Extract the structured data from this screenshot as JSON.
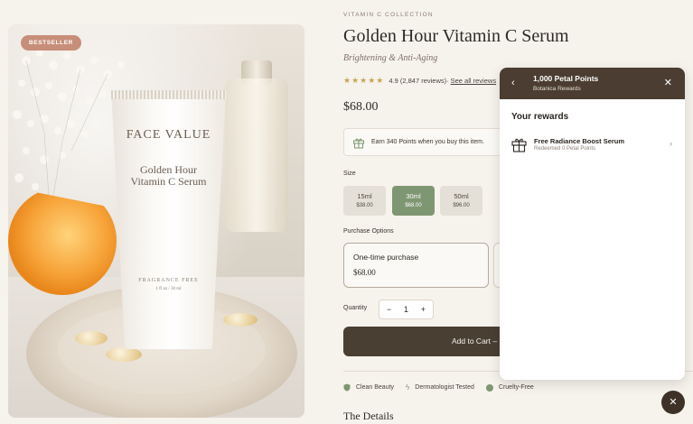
{
  "product_image": {
    "badge": "BESTSELLER",
    "tube_brand": "FACE VALUE",
    "tube_name_line1": "Golden Hour",
    "tube_name_line2": "Vitamin C Serum",
    "tube_fragrance": "FRAGRANCE FREE",
    "tube_volume": "1 fl oz / 30 ml"
  },
  "product": {
    "collection": "VITAMIN C COLLECTION",
    "title": "Golden Hour Vitamin C Serum",
    "subtitle": "Brightening & Anti-Aging",
    "stars": "★★★★★",
    "rating_text": "4.9 (2,847 reviews)·",
    "reviews_link": "See all reviews",
    "price": "$68.00",
    "points_message": "Earn 340 Points when you buy this item."
  },
  "size": {
    "label": "Size",
    "options": [
      {
        "name": "15ml",
        "price": "$38.00"
      },
      {
        "name": "30ml",
        "price": "$68.00"
      },
      {
        "name": "50ml",
        "price": "$96.00"
      }
    ],
    "selected": "30ml"
  },
  "purchase": {
    "label": "Purchase Options",
    "option_title": "One-time purchase",
    "option_price": "$68.00"
  },
  "quantity": {
    "label": "Quantity",
    "minus": "−",
    "value": "1",
    "plus": "+"
  },
  "cart": {
    "button_label": "Add to Cart –"
  },
  "features": [
    {
      "label": "Clean Beauty",
      "icon": "shield-icon"
    },
    {
      "label": "Dermatologist Tested",
      "icon": "sparkle-icon"
    },
    {
      "label": "Cruelty-Free",
      "icon": "dot-icon"
    }
  ],
  "details_heading": "The Details",
  "rewards_panel": {
    "title": "1,000 Petal Points",
    "subtitle": "Botanica Rewards",
    "section_heading": "Your rewards",
    "reward_title": "Free Radiance Boost Serum",
    "reward_subtitle": "Redeemed 0 Petal Points"
  },
  "colors": {
    "accent_green": "#7f9672",
    "dark_brown": "#4b3d31",
    "badge": "#c78e79",
    "star": "#c9a455"
  }
}
